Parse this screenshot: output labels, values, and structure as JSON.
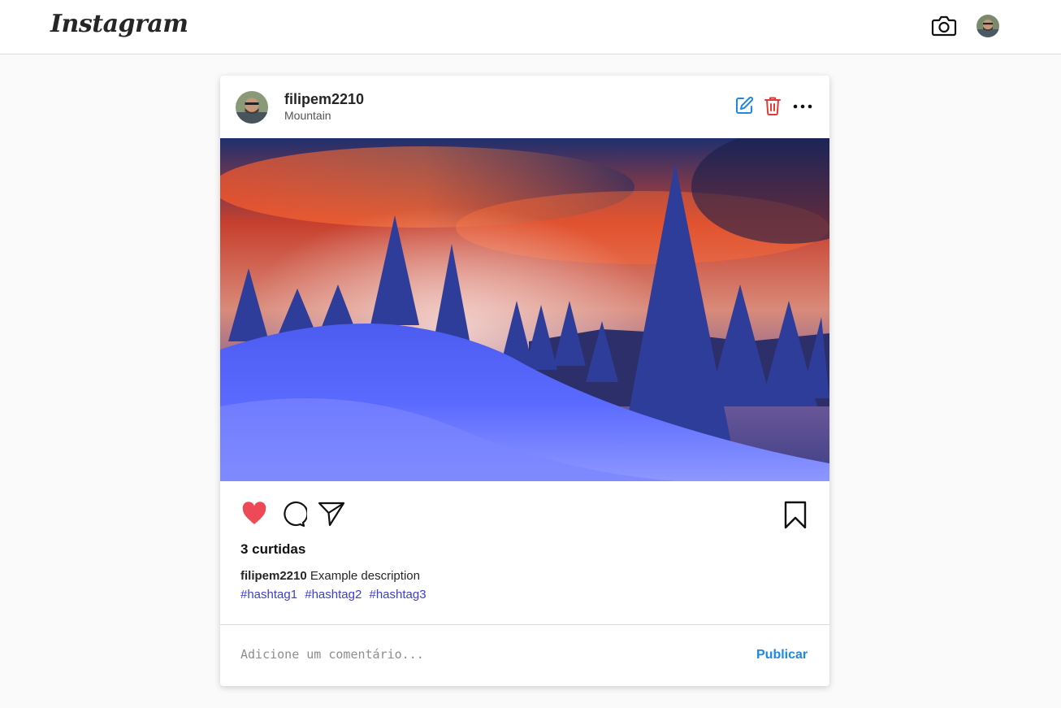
{
  "app": {
    "logo_text": "Instagram"
  },
  "header": {
    "camera_icon": "camera-icon",
    "avatar": "profile-avatar"
  },
  "post": {
    "username": "filipem2210",
    "location": "Mountain",
    "edit_icon": "edit-icon",
    "delete_icon": "trash-icon",
    "more_icon": "more-icon",
    "likes_text": "3 curtidas",
    "caption_user": "filipem2210",
    "caption_text": "Example description",
    "hashtags": [
      "#hashtag1",
      "#hashtag2",
      "#hashtag3"
    ],
    "liked": true
  },
  "comment": {
    "placeholder": "Adicione um comentário...",
    "value": "",
    "publish_label": "Publicar"
  },
  "colors": {
    "like": "#ed4956",
    "edit": "#1e88e5",
    "delete": "#e53935",
    "hashtag": "#3b3fce",
    "publish": "#1e88e5"
  }
}
